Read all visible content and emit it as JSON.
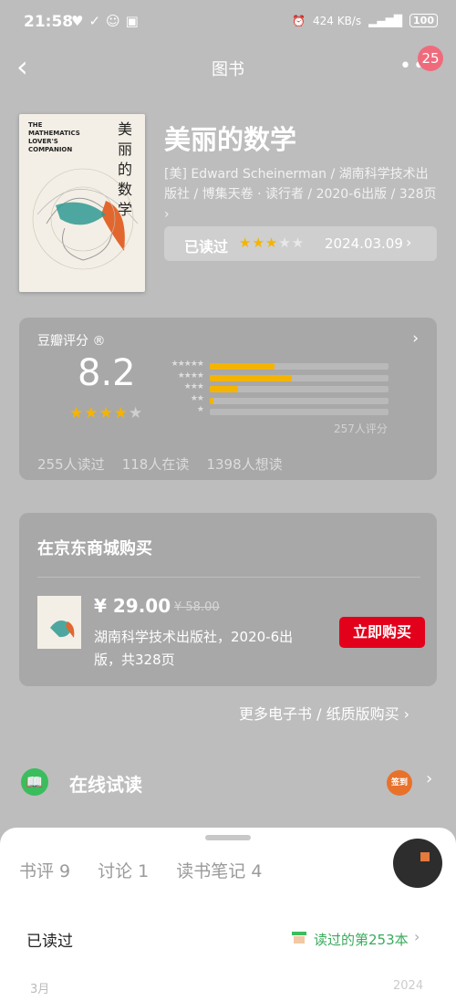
{
  "status_bar": {
    "time": "21:58",
    "network_speed": "424 KB/s",
    "battery": "100"
  },
  "nav": {
    "title": "图书",
    "badge": "25"
  },
  "book": {
    "title": "美丽的数学",
    "cover_en": "THE\nMATHEMATICS\nLOVER'S\nCOMPANION",
    "cover_zh": "美丽的数学",
    "meta": "[美] Edward Scheinerman / 湖南科学技术出版社 / 博集天卷 · 读行者 / 2020-6出版 / 328页 ›",
    "read_label": "已读过",
    "user_rating": 3,
    "read_date": "2024.03.09"
  },
  "rating": {
    "header": "豆瓣评分 ®",
    "score": "8.2",
    "stars": 4,
    "distribution": [
      {
        "stars": "★★★★★",
        "fraction": 0.36
      },
      {
        "stars": "★★★★",
        "fraction": 0.46
      },
      {
        "stars": "★★★",
        "fraction": 0.16
      },
      {
        "stars": "★★",
        "fraction": 0.02
      },
      {
        "stars": "★",
        "fraction": 0.0
      }
    ],
    "count": "257人评分",
    "read": "255人读过",
    "reading": "118人在读",
    "want": "1398人想读"
  },
  "buy": {
    "header": "在京东商城购买",
    "price": "¥ 29.00",
    "old_price": "¥ 58.00",
    "publisher": "湖南科学技术出版社，2020-6出版，共328页",
    "button": "立即购买",
    "more": "更多电子书 / 纸质版购买 ›"
  },
  "online": {
    "label": "在线试读",
    "sign_label": "签到"
  },
  "sheet": {
    "tabs": [
      "书评 9",
      "讨论 1",
      "读书笔记 4"
    ],
    "status": "已读过",
    "nth": "读过的第253本",
    "month": "3月",
    "year": "2024"
  },
  "colors": {
    "star": "#f5b400",
    "buy_button": "#e3001b",
    "green": "#3bbd5e",
    "badge": "#ef6b7c"
  }
}
